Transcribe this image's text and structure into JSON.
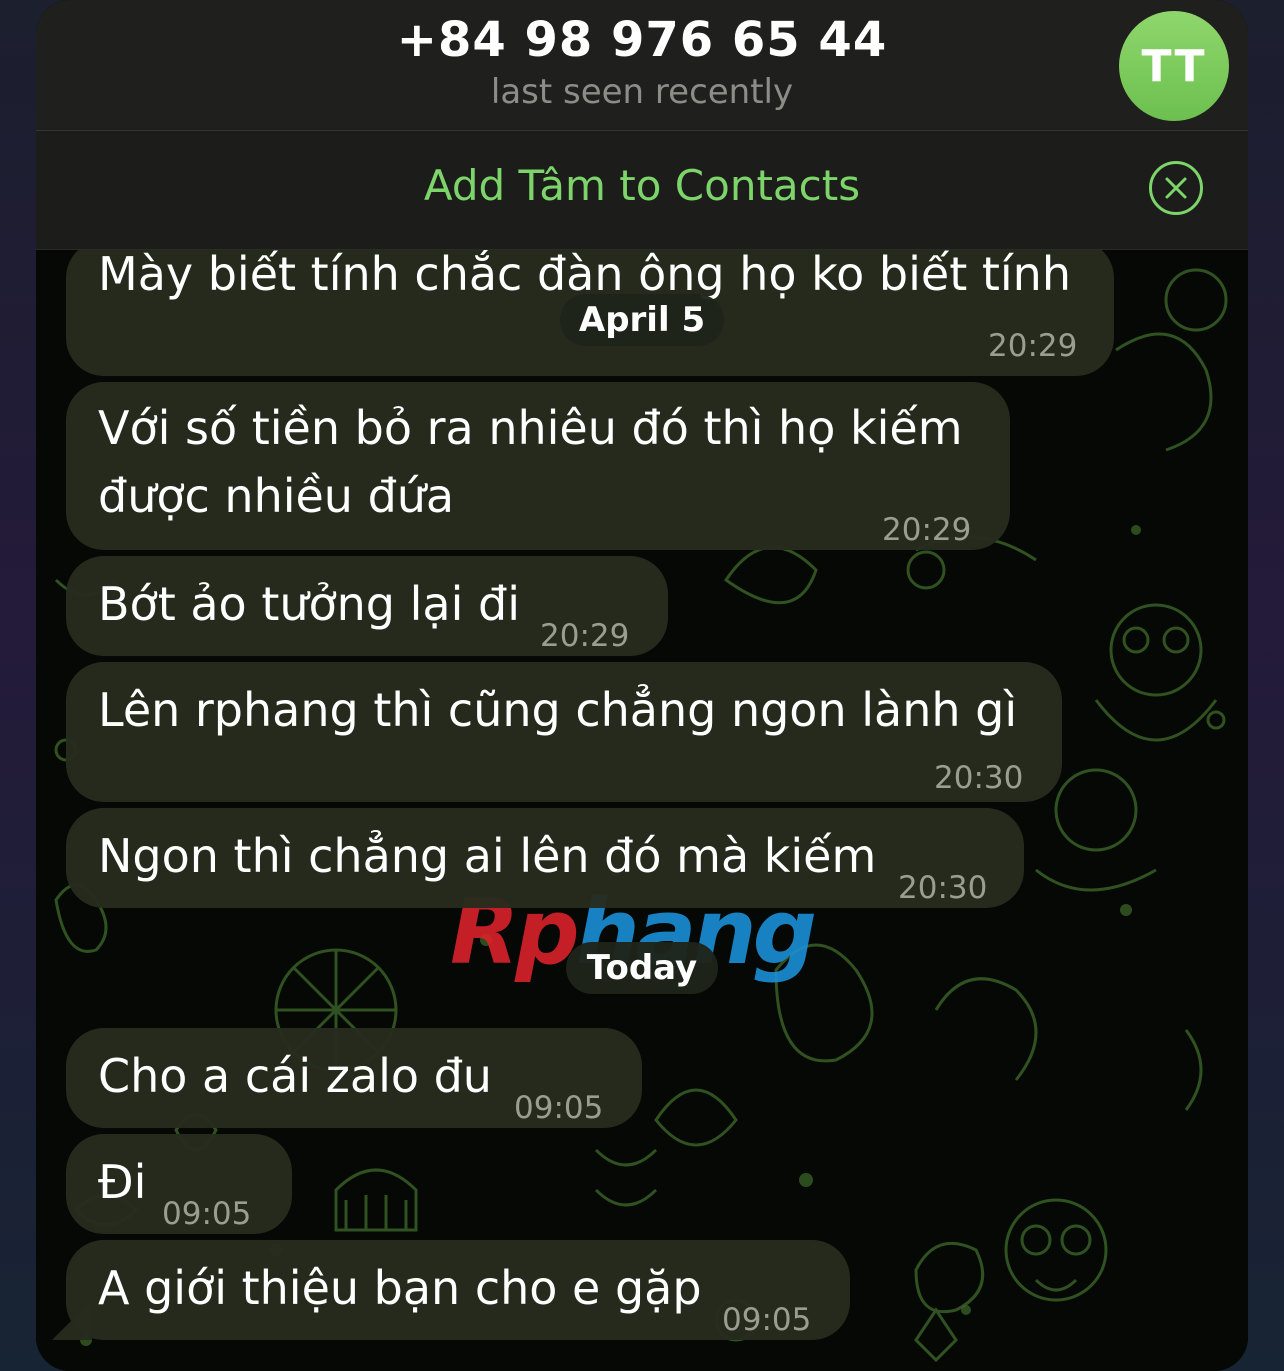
{
  "header": {
    "title": "+84 98 976 65 44",
    "status": "last seen recently",
    "avatar_initials": "TT",
    "avatar_color": "#79cb5c"
  },
  "add_contact_bar": {
    "label": "Add Tâm to Contacts",
    "accent_color": "#7dd46a",
    "close_icon": "close-circle-icon"
  },
  "date_separators": {
    "first": "April 5",
    "second": "Today"
  },
  "messages": [
    {
      "text": "Mày biết tính chắc đàn ông họ ko biết tính",
      "time": "20:29"
    },
    {
      "line1": "Với số tiền bỏ ra nhiêu đó thì họ kiếm",
      "line2": "được nhiều đứa",
      "time": "20:29"
    },
    {
      "text": "Bớt ảo tưởng lại đi",
      "time": "20:29"
    },
    {
      "text": "Lên rphang thì cũng chẳng ngon lành gì",
      "time": "20:30"
    },
    {
      "text": "Ngon thì chẳng ai lên đó mà kiếm",
      "time": "20:30"
    },
    {
      "text": "Cho a cái zalo đu",
      "time": "09:05"
    },
    {
      "text": "Đi",
      "time": "09:05"
    },
    {
      "text": "A giới thiệu bạn cho e gặp",
      "time": "09:05"
    }
  ],
  "watermark": {
    "part1": "Rp",
    "part2": "hang"
  }
}
